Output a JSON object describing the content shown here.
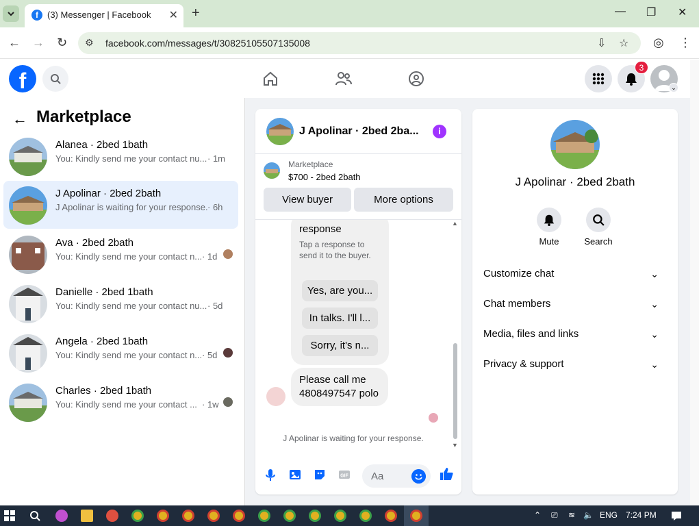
{
  "browser": {
    "tab_title": "(3) Messenger | Facebook",
    "url": "facebook.com/messages/t/30825105507135008"
  },
  "fb": {
    "notification_count": "3"
  },
  "sidebar": {
    "title": "Marketplace",
    "conversations": [
      {
        "name": "Alanea · 2bed 1bath",
        "preview": "You: Kindly send me your contact nu...",
        "time": "· 1m",
        "active": false
      },
      {
        "name": "J Apolinar · 2bed 2bath",
        "preview": "J Apolinar is waiting for your response.",
        "time": "· 6h",
        "active": true
      },
      {
        "name": "Ava · 2bed 2bath",
        "preview": "You: Kindly send me your contact n...",
        "time": "· 1d",
        "active": false
      },
      {
        "name": "Danielle · 2bed 1bath",
        "preview": "You: Kindly send me your contact nu...",
        "time": "· 5d",
        "active": false
      },
      {
        "name": "Angela · 2bed 1bath",
        "preview": "You: Kindly send me your contact n...",
        "time": "· 5d",
        "active": false
      },
      {
        "name": "Charles · 2bed 1bath",
        "preview": "You: Kindly send me your contact ...",
        "time": "· 1w",
        "active": false
      }
    ]
  },
  "chat": {
    "title": "J Apolinar · 2bed 2ba...",
    "marketplace_label": "Marketplace",
    "listing": "$700 - 2bed 2bath",
    "view_buyer": "View buyer",
    "more_options": "More options",
    "quick_reply_title": "response",
    "quick_reply_sub": "Tap a response to send it to the buyer.",
    "quick_replies": [
      "Yes, are you...",
      "In talks. I'll l...",
      "Sorry, it's n..."
    ],
    "incoming_message": "Please call me 4808497547 polo",
    "waiting_text": "J Apolinar is waiting for your response.",
    "composer_placeholder": "Aa"
  },
  "info_panel": {
    "name": "J Apolinar · 2bed 2bath",
    "actions": [
      "Mute",
      "Search"
    ],
    "sections": [
      "Customize chat",
      "Chat members",
      "Media, files and links",
      "Privacy & support"
    ]
  },
  "taskbar": {
    "lang": "ENG",
    "time": "7:24 PM"
  }
}
